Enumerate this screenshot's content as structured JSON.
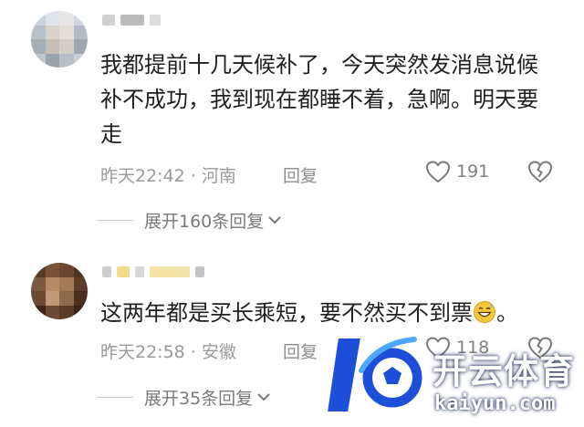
{
  "comments": [
    {
      "text": "我都提前十几天候补了，今天突然发消息说候补不成功，我到现在都睡不着，急啊。明天要走",
      "time": "昨天22:42 · 河南",
      "reply_label": "回复",
      "like_count": "191",
      "expand_label": "展开160条回复"
    },
    {
      "text": "这两年都是买长乘短，要不然买不到票",
      "text_suffix": "。",
      "emoji_icon": "grinning-sweat-emoji-icon",
      "time": "昨天22:58 · 安徽",
      "reply_label": "回复",
      "like_count": "118",
      "expand_label": "展开35条回复"
    }
  ],
  "watermark": {
    "brand": "开云体育",
    "url": "kaiyun.com"
  },
  "icons": {
    "like": "heart-outline-icon",
    "dislike": "broken-heart-icon",
    "expand": "chevron-down-icon"
  },
  "colors": {
    "text": "#1f1f1f",
    "meta": "#9a9a9a",
    "watermark_blue": "#1e4fd8"
  }
}
